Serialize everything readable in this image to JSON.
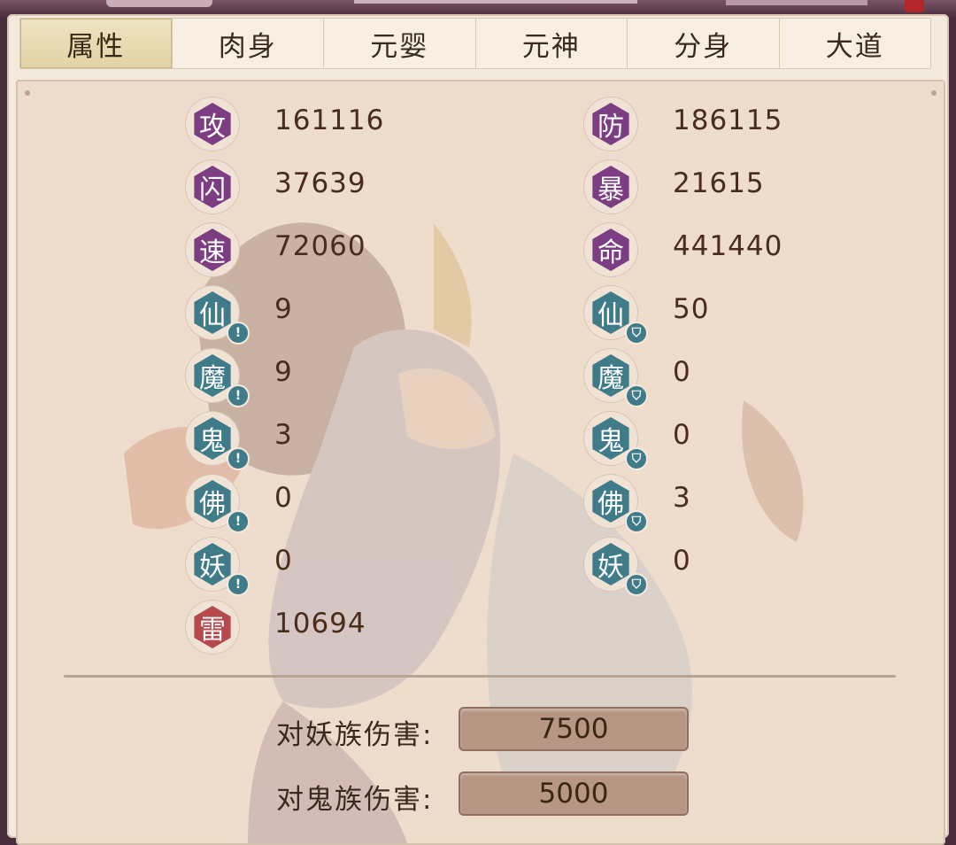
{
  "tabs": [
    {
      "label": "属性",
      "active": true
    },
    {
      "label": "肉身",
      "active": false
    },
    {
      "label": "元婴",
      "active": false
    },
    {
      "label": "元神",
      "active": false
    },
    {
      "label": "分身",
      "active": false
    },
    {
      "label": "大道",
      "active": false
    }
  ],
  "stats_left": [
    {
      "glyph": "攻",
      "value": "161116",
      "color": "purple",
      "badge": ""
    },
    {
      "glyph": "闪",
      "value": "37639",
      "color": "purple",
      "badge": ""
    },
    {
      "glyph": "速",
      "value": "72060",
      "color": "purple",
      "badge": ""
    },
    {
      "glyph": "仙",
      "value": "9",
      "color": "teal",
      "badge": "exclamation"
    },
    {
      "glyph": "魔",
      "value": "9",
      "color": "teal",
      "badge": "exclamation"
    },
    {
      "glyph": "鬼",
      "value": "3",
      "color": "teal",
      "badge": "exclamation"
    },
    {
      "glyph": "佛",
      "value": "0",
      "color": "teal",
      "badge": "exclamation"
    },
    {
      "glyph": "妖",
      "value": "0",
      "color": "teal",
      "badge": "exclamation"
    },
    {
      "glyph": "雷",
      "value": "10694",
      "color": "red",
      "badge": ""
    }
  ],
  "stats_right": [
    {
      "glyph": "防",
      "value": "186115",
      "color": "purple",
      "badge": ""
    },
    {
      "glyph": "暴",
      "value": "21615",
      "color": "purple",
      "badge": ""
    },
    {
      "glyph": "命",
      "value": "441440",
      "color": "purple",
      "badge": ""
    },
    {
      "glyph": "仙",
      "value": "50",
      "color": "teal",
      "badge": "shield"
    },
    {
      "glyph": "魔",
      "value": "0",
      "color": "teal",
      "badge": "shield"
    },
    {
      "glyph": "鬼",
      "value": "0",
      "color": "teal",
      "badge": "shield"
    },
    {
      "glyph": "佛",
      "value": "3",
      "color": "teal",
      "badge": "shield"
    },
    {
      "glyph": "妖",
      "value": "0",
      "color": "teal",
      "badge": "shield"
    }
  ],
  "damage": [
    {
      "label": "对妖族伤害:",
      "value": "7500"
    },
    {
      "label": "对鬼族伤害:",
      "value": "5000"
    }
  ],
  "colors": {
    "purple": "#7d3d83",
    "teal": "#3f7b88",
    "red": "#b5494c"
  }
}
